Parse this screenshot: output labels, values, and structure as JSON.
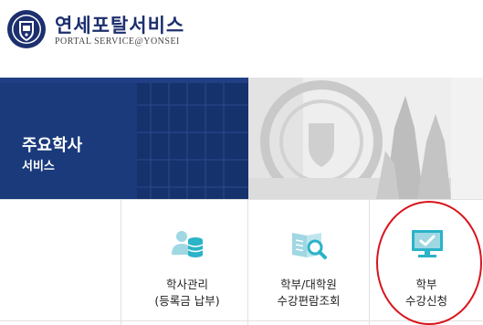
{
  "header": {
    "title": "연세포탈서비스",
    "subtitle_prefix": "PORTAL SERVICE",
    "subtitle_at": "@",
    "subtitle_suffix": "YONSEI",
    "logo_icon": "yonsei-shield-emblem"
  },
  "banner": {
    "title": "주요학사",
    "subtitle": "서비스",
    "color": "#1a3a7c"
  },
  "tiles": [
    {
      "line1": "",
      "line2": "",
      "icon": "none"
    },
    {
      "line1": "학사관리",
      "line2": "(등록금 납부)",
      "icon": "user-database-icon"
    },
    {
      "line1": "학부/대학원",
      "line2": "수강편람조회",
      "icon": "book-search-icon"
    },
    {
      "line1": "학부",
      "line2": "수강신청",
      "icon": "monitor-check-icon"
    }
  ],
  "colors": {
    "accent": "#2bb3c8",
    "brand": "#1c2f6e",
    "highlight": "#d8151c"
  }
}
